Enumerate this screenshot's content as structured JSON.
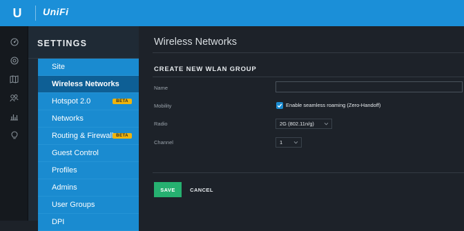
{
  "app": {
    "logo_letter": "U",
    "logo_name": "UniFi"
  },
  "iconbar": {
    "icons": [
      "dashboard-icon",
      "map-target-icon",
      "map-icon",
      "clients-icon",
      "statistics-icon",
      "insights-icon"
    ]
  },
  "settings": {
    "title": "SETTINGS",
    "menu": [
      {
        "label": "Site"
      },
      {
        "label": "Wireless Networks",
        "active": true
      },
      {
        "label": "Hotspot 2.0",
        "badge": "BETA"
      },
      {
        "label": "Networks"
      },
      {
        "label": "Routing & Firewall",
        "badge": "BETA"
      },
      {
        "label": "Guest Control"
      },
      {
        "label": "Profiles"
      },
      {
        "label": "Admins"
      },
      {
        "label": "User Groups"
      },
      {
        "label": "DPI"
      }
    ]
  },
  "main": {
    "title": "Wireless Networks",
    "section_title": "CREATE NEW WLAN GROUP",
    "labels": {
      "name": "Name",
      "mobility": "Mobility",
      "radio": "Radio",
      "channel": "Channel"
    },
    "name_value": "",
    "mobility_checked": true,
    "mobility_text": "Enable seamless roaming (Zero-Handoff)",
    "radio_value": "2G (802.11n/g)",
    "channel_value": "1",
    "save_label": "SAVE",
    "cancel_label": "CANCEL"
  },
  "colors": {
    "topbar": "#1b8fd8",
    "menu_item": "#1a8bd0",
    "menu_active": "#0e5f95",
    "beta_badge": "#f0b40a",
    "save_button": "#26b070",
    "background": "#1d2229"
  }
}
